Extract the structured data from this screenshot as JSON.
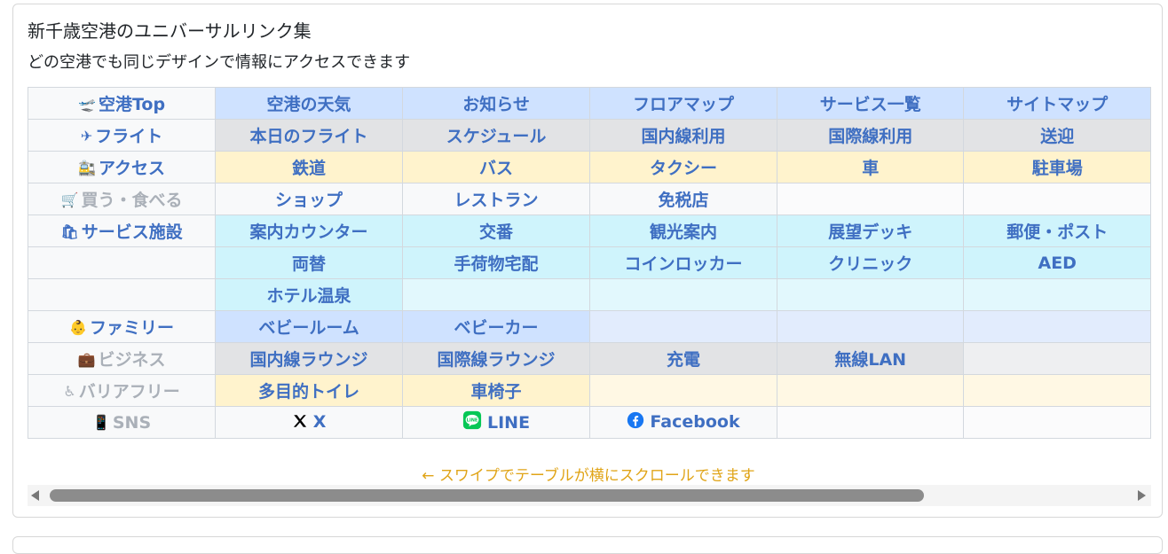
{
  "header": {
    "title": "新千歳空港のユニバーサルリンク集",
    "subtitle": "どの空港でも同じデザインで情報にアクセスできます"
  },
  "colors": {
    "link_text": "#3f6fc2",
    "muted_header": "#aab0b8",
    "hint_text": "#e0a417",
    "row_blue": "#cfe2ff",
    "row_gray": "#e2e3e5",
    "row_yellow": "#fff3cd",
    "row_cyan": "#cff4fc"
  },
  "table": {
    "rows": [
      {
        "tone": "blue",
        "header": "空港Top",
        "icon": "🛫",
        "icon_name": "airport-icon",
        "muted": false,
        "cells": [
          "空港の天気",
          "お知らせ",
          "フロアマップ",
          "サービス一覧",
          "サイトマップ"
        ]
      },
      {
        "tone": "gray",
        "header": "フライト",
        "icon": "✈",
        "icon_name": "airplane-icon",
        "muted": false,
        "cells": [
          "本日のフライト",
          "スケジュール",
          "国内線利用",
          "国際線利用",
          "送迎"
        ]
      },
      {
        "tone": "yellow",
        "header": "アクセス",
        "icon": "🚉",
        "icon_name": "train-icon",
        "muted": false,
        "cells": [
          "鉄道",
          "バス",
          "タクシー",
          "車",
          "駐車場"
        ]
      },
      {
        "tone": "light",
        "header": "買う・食べる",
        "icon": "🛒",
        "icon_name": "cart-icon",
        "muted": true,
        "cells": [
          "ショップ",
          "レストラン",
          "免税店",
          "",
          ""
        ]
      },
      {
        "tone": "cyan",
        "header": "サービス施設",
        "icon": "🛍",
        "icon_name": "shopping-bag-icon",
        "muted": false,
        "cells": [
          "案内カウンター",
          "交番",
          "観光案内",
          "展望デッキ",
          "郵便・ポスト"
        ]
      },
      {
        "tone": "cyan",
        "header": "",
        "icon": "",
        "icon_name": "",
        "muted": false,
        "cells": [
          "両替",
          "手荷物宅配",
          "コインロッカー",
          "クリニック",
          "AED"
        ]
      },
      {
        "tone": "cyan",
        "header": "",
        "icon": "",
        "icon_name": "",
        "muted": false,
        "cells": [
          "ホテル温泉",
          "",
          "",
          "",
          ""
        ]
      },
      {
        "tone": "blue",
        "header": "ファミリー",
        "icon": "👶",
        "icon_name": "baby-icon",
        "muted": false,
        "cells": [
          "ベビールーム",
          "ベビーカー",
          "",
          "",
          ""
        ]
      },
      {
        "tone": "gray",
        "header": "ビジネス",
        "icon": "💼",
        "icon_name": "briefcase-icon",
        "muted": true,
        "cells": [
          "国内線ラウンジ",
          "国際線ラウンジ",
          "充電",
          "無線LAN",
          ""
        ]
      },
      {
        "tone": "yellow",
        "header": "バリアフリー",
        "icon": "♿",
        "icon_name": "wheelchair-icon",
        "muted": true,
        "cells": [
          "多目的トイレ",
          "車椅子",
          "",
          "",
          ""
        ]
      },
      {
        "tone": "light",
        "header": "SNS",
        "icon": "📱",
        "icon_name": "phone-icon",
        "muted": true,
        "cells": [
          "X",
          "LINE",
          "Facebook",
          "",
          ""
        ],
        "cell_icons": [
          "x-logo-icon",
          "line-logo-icon",
          "facebook-logo-icon",
          "",
          ""
        ]
      }
    ]
  },
  "scroll_hint": "← スワイプでテーブルが横にスクロールできます",
  "scrollbar": {
    "thumb_fraction": 0.81
  }
}
